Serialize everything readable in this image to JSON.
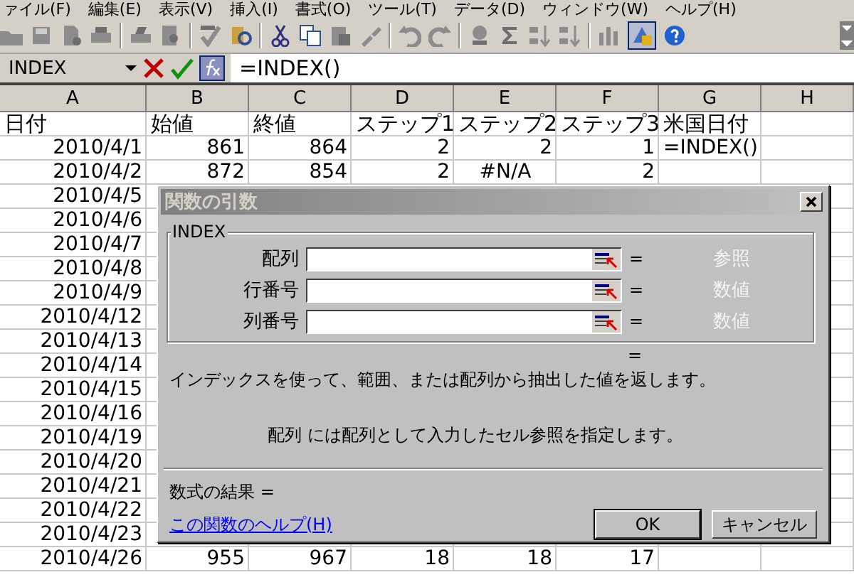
{
  "menu_bar": {
    "items": [
      "ァイル(F)",
      "編集(E)",
      "表示(V)",
      "挿入(I)",
      "書式(O)",
      "ツール(T)",
      "データ(D)",
      "ウィンドウ(W)",
      "ヘルプ(H)"
    ]
  },
  "formula_bar": {
    "name_box": "INDEX",
    "formula": "=INDEX()"
  },
  "sheet": {
    "columns": [
      "A",
      "B",
      "C",
      "D",
      "E",
      "F",
      "G",
      "H"
    ],
    "rows": [
      {
        "cells": [
          {
            "text": "日付",
            "kind": "text"
          },
          {
            "text": "始値",
            "kind": "text"
          },
          {
            "text": "終値",
            "kind": "text"
          },
          {
            "text": "ステップ1",
            "kind": "text"
          },
          {
            "text": "ステップ2",
            "kind": "text"
          },
          {
            "text": "ステップ3",
            "kind": "text"
          },
          {
            "text": "米国日付",
            "kind": "text"
          }
        ]
      },
      {
        "cells": [
          {
            "text": "2010/4/1",
            "kind": "number"
          },
          {
            "text": "861",
            "kind": "number"
          },
          {
            "text": "864",
            "kind": "number"
          },
          {
            "text": "2",
            "kind": "number"
          },
          {
            "text": "2",
            "kind": "number"
          },
          {
            "text": "1",
            "kind": "number"
          },
          {
            "text": "=INDEX()",
            "kind": "text"
          }
        ]
      },
      {
        "cells": [
          {
            "text": "2010/4/2",
            "kind": "number"
          },
          {
            "text": "872",
            "kind": "number"
          },
          {
            "text": "854",
            "kind": "number"
          },
          {
            "text": "2",
            "kind": "number"
          },
          {
            "text": "#N/A",
            "kind": "error"
          },
          {
            "text": "2",
            "kind": "number"
          }
        ]
      },
      {
        "cells": [
          {
            "text": "2010/4/5",
            "kind": "number"
          }
        ]
      },
      {
        "cells": [
          {
            "text": "2010/4/6",
            "kind": "number"
          }
        ]
      },
      {
        "cells": [
          {
            "text": "2010/4/7",
            "kind": "number"
          }
        ]
      },
      {
        "cells": [
          {
            "text": "2010/4/8",
            "kind": "number"
          }
        ]
      },
      {
        "cells": [
          {
            "text": "2010/4/9",
            "kind": "number"
          }
        ]
      },
      {
        "cells": [
          {
            "text": "2010/4/12",
            "kind": "number"
          }
        ]
      },
      {
        "cells": [
          {
            "text": "2010/4/13",
            "kind": "number"
          }
        ]
      },
      {
        "cells": [
          {
            "text": "2010/4/14",
            "kind": "number"
          }
        ]
      },
      {
        "cells": [
          {
            "text": "2010/4/15",
            "kind": "number"
          }
        ]
      },
      {
        "cells": [
          {
            "text": "2010/4/16",
            "kind": "number"
          }
        ]
      },
      {
        "cells": [
          {
            "text": "2010/4/19",
            "kind": "number"
          }
        ]
      },
      {
        "cells": [
          {
            "text": "2010/4/20",
            "kind": "number"
          }
        ]
      },
      {
        "cells": [
          {
            "text": "2010/4/21",
            "kind": "number"
          }
        ]
      },
      {
        "cells": [
          {
            "text": "2010/4/22",
            "kind": "number"
          }
        ]
      },
      {
        "cells": [
          {
            "text": "2010/4/23",
            "kind": "number"
          }
        ]
      },
      {
        "cells": [
          {
            "text": "2010/4/26",
            "kind": "number"
          },
          {
            "text": "955",
            "kind": "number"
          },
          {
            "text": "967",
            "kind": "number"
          },
          {
            "text": "18",
            "kind": "number"
          },
          {
            "text": "18",
            "kind": "number"
          },
          {
            "text": "17",
            "kind": "number"
          }
        ]
      }
    ]
  },
  "dialog": {
    "title": "関数の引数",
    "group": "INDEX",
    "arguments": [
      {
        "label": "配列",
        "hint": "参照"
      },
      {
        "label": "行番号",
        "hint": "数値"
      },
      {
        "label": "列番号",
        "hint": "数値"
      }
    ],
    "equals": "=",
    "description": "インデックスを使って、範囲、または配列から抽出した値を返します。",
    "argument_help": "配列 には配列として入力したセル参照を指定します。",
    "result": "数式の結果 =",
    "help_link": "この関数のヘルプ(H)",
    "buttons": [
      {
        "label": "OK",
        "default": true
      },
      {
        "label": "キャンセル",
        "default": false
      }
    ]
  }
}
